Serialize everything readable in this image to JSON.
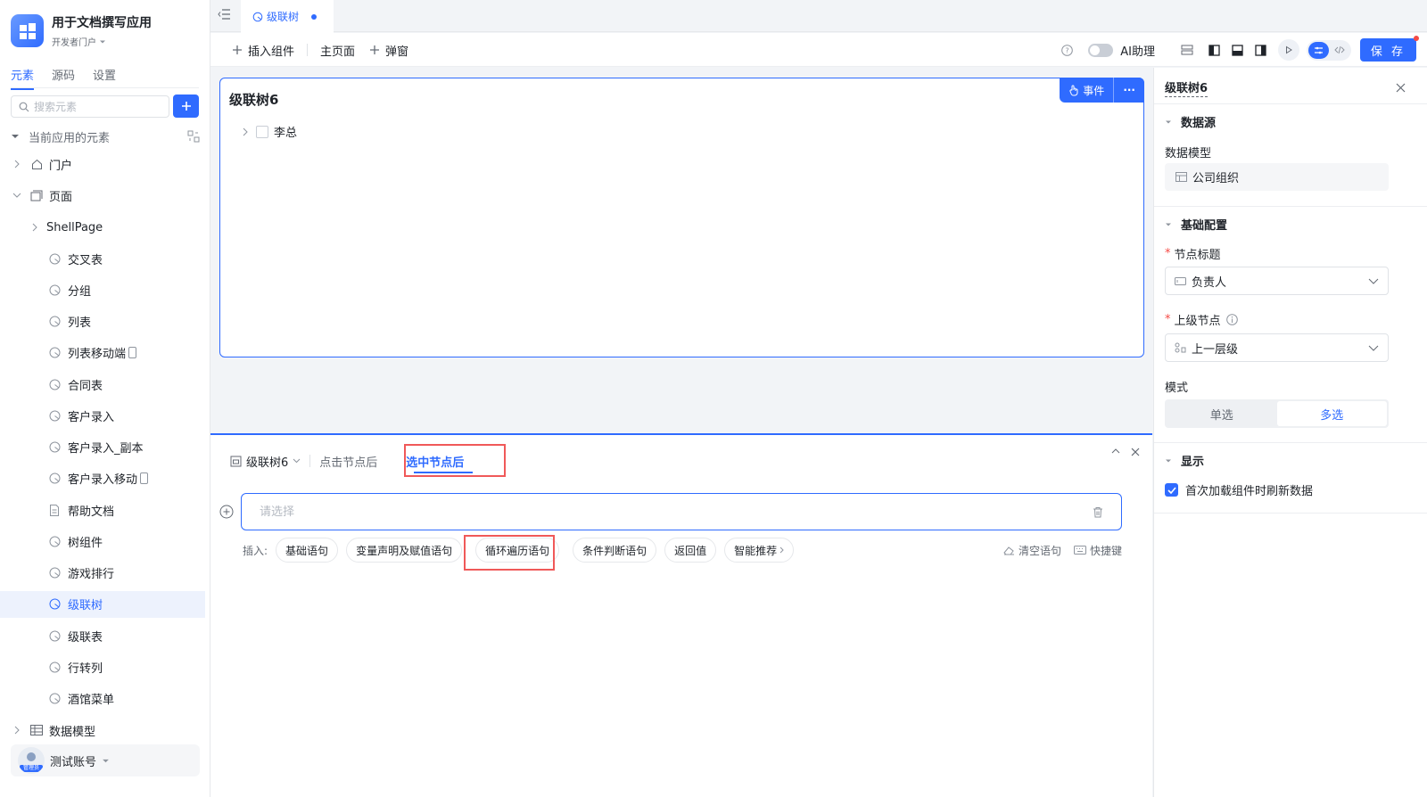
{
  "app": {
    "title": "用于文档撰写应用",
    "portal": "开发者门户"
  },
  "sidebar": {
    "tabs": [
      "元素",
      "源码",
      "设置"
    ],
    "search_placeholder": "搜索元素",
    "section_label": "当前应用的元素",
    "portal_label": "门户",
    "pages_label": "页面",
    "shell_label": "ShellPage",
    "pages": [
      "交叉表",
      "分组",
      "列表",
      "列表移动端",
      "合同表",
      "客户录入",
      "客户录入_副本",
      "客户录入移动",
      "帮助文档",
      "树组件",
      "游戏排行",
      "级联树",
      "级联表",
      "行转列",
      "酒馆菜单"
    ],
    "data_model_label": "数据模型",
    "user_name": "测试账号",
    "user_role": "管理员"
  },
  "tabbar": {
    "active_tab": "级联树"
  },
  "toolbar": {
    "insert_label": "插入组件",
    "main_page_label": "主页面",
    "popup_label": "弹窗",
    "ai_label": "AI助理",
    "save_label": "保 存"
  },
  "canvas": {
    "component_title": "级联树6",
    "event_label": "事件",
    "more_label": "···",
    "tree_node": "李总"
  },
  "events": {
    "component_tab": "级联树6",
    "tab_click": "点击节点后",
    "tab_selected": "选中节点后",
    "input_placeholder": "请选择",
    "insert_label": "插入:",
    "chips": [
      "基础语句",
      "变量声明及赋值语句",
      "循环遍历语句",
      "条件判断语句",
      "返回值",
      "智能推荐"
    ],
    "clear_label": "清空语句",
    "shortcut_label": "快捷键"
  },
  "props": {
    "title": "级联树6",
    "datasource_section": "数据源",
    "data_model_label": "数据模型",
    "data_model_value": "公司组织",
    "basic_section": "基础配置",
    "node_title_label": "节点标题",
    "node_title_value": "负责人",
    "parent_label": "上级节点",
    "parent_value": "上一层级",
    "mode_label": "模式",
    "mode_single": "单选",
    "mode_multi": "多选",
    "display_section": "显示",
    "refresh_label": "首次加载组件时刷新数据"
  },
  "colors": {
    "accent": "#2f6bff",
    "highlight": "#f05959"
  }
}
